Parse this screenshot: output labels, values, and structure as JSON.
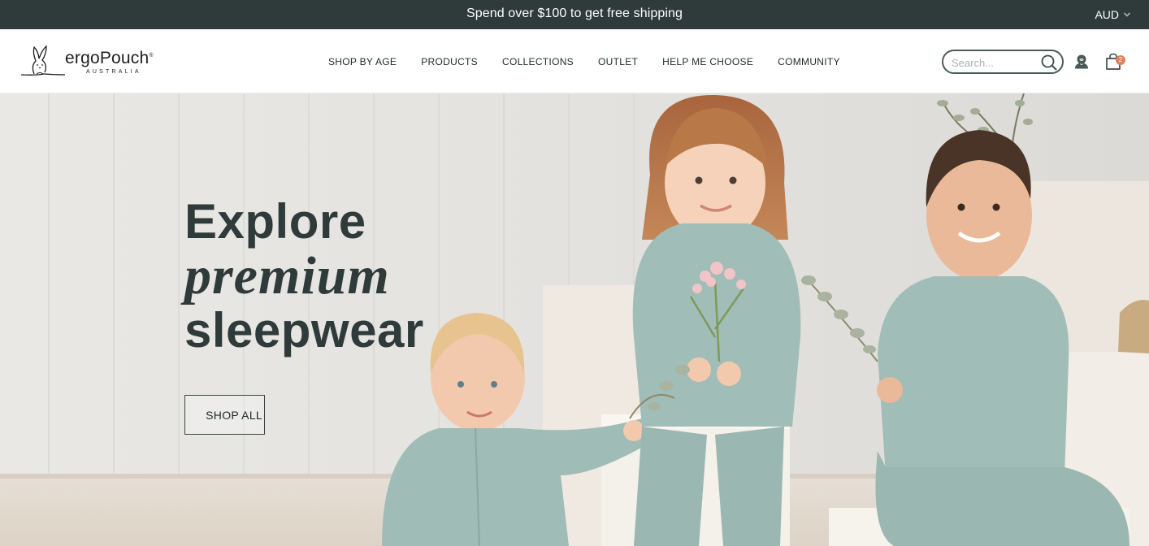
{
  "announcement": {
    "text": "Spend over $100 to get free shipping",
    "currency": "AUD"
  },
  "header": {
    "logo": {
      "wordmark_light": "ergo",
      "wordmark_bold": "Pouch",
      "trademark": "®",
      "subtitle": "AUSTRALIA"
    },
    "nav": [
      {
        "label": "SHOP BY AGE"
      },
      {
        "label": "PRODUCTS"
      },
      {
        "label": "COLLECTIONS"
      },
      {
        "label": "OUTLET"
      },
      {
        "label": "HELP ME CHOOSE"
      },
      {
        "label": "COMMUNITY"
      }
    ],
    "search": {
      "placeholder": "Search...",
      "value": ""
    },
    "cart_count": "2",
    "icons": [
      "search-icon",
      "account-icon",
      "cart-icon",
      "chevron-down-icon"
    ]
  },
  "hero": {
    "line1": "Explore",
    "line2": "premium",
    "line3": "sleepwear",
    "cta": "SHOP ALL",
    "image": "three children in sage green patterned pajamas holding flowers and eucalyptus"
  },
  "colors": {
    "announcement_bg": "#2f3b3b",
    "text_dark": "#2f3b3b",
    "pajama_sage": "#9fb9b3",
    "cart_badge": "#e1805a",
    "hero_bg": "#e7e6e3"
  }
}
